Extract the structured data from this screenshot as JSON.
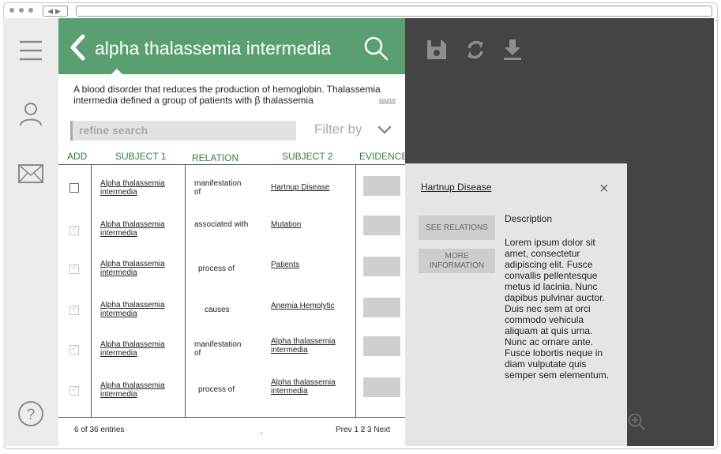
{
  "header": {
    "title": "alpha thalassemia intermedia",
    "description": "A blood disorder that reduces the production of hemoglobin. Thalassemia intermedia defined a group of patients with β thalassemia",
    "source_label": "source"
  },
  "search": {
    "placeholder": "refine search",
    "filter_label": "Filter by"
  },
  "table": {
    "columns": [
      "ADD",
      "SUBJECT 1",
      "RELATION",
      "SUBJECT 2",
      "EVIDENCE"
    ],
    "rows": [
      {
        "checked": false,
        "subject1": "Alpha thalassemia intermedia",
        "relation": "manifestation of",
        "subject2": "Hartnup Disease"
      },
      {
        "checked": true,
        "subject1": "Alpha thalassemia intermedia",
        "relation": "associated with",
        "subject2": "Mutation"
      },
      {
        "checked": true,
        "subject1": "Alpha thalassemia intermedia",
        "relation": "process of",
        "subject2": "Patients"
      },
      {
        "checked": true,
        "subject1": "Alpha thalassemia intermedia",
        "relation": "causes",
        "subject2": "Anemia Hemolytic"
      },
      {
        "checked": true,
        "subject1": "Alpha thalassemia intermedia",
        "relation": "manifestation of",
        "subject2": "Alpha thalassemia intermedia"
      },
      {
        "checked": true,
        "subject1": "Alpha thalassemia intermedia",
        "relation": "process of",
        "subject2": "Alpha thalassemia intermedia"
      }
    ]
  },
  "footer": {
    "entries": "6 of 36 entries",
    "pager": {
      "prev": "Prev",
      "pages": [
        "1",
        "2",
        "3"
      ],
      "current": "2",
      "next": "Next"
    }
  },
  "detail": {
    "title": "Hartnup Disease",
    "close": "×",
    "see_relations": "SEE RELATIONS",
    "more_info_line1": "MORE",
    "more_info_line2": "INFORMATION",
    "description_heading": "Description",
    "description_body": "Lorem ipsum dolor sit amet, consectetur adipiscing elit. Fusce convallis pellentesque metus id lacinia. Nunc dapibus pulvinar auctor. Duis nec sem at orci commodo vehicula aliquam at quis urna. Nunc ac ornare ante. Fusce lobortis neque in diam vulputate quis semper sem elementum."
  },
  "icons": {
    "sidebar": [
      "menu-icon",
      "user-icon",
      "mail-icon",
      "help-icon"
    ],
    "header": [
      "back-icon",
      "search-icon"
    ],
    "toolbar": [
      "save-icon",
      "refresh-icon",
      "download-icon"
    ],
    "panel": [
      "zoom-in-icon"
    ]
  },
  "colors": {
    "accent": "#5a9f72",
    "text_accent": "#2e7d3c",
    "dark_panel": "#444444"
  },
  "help_glyph": "?"
}
